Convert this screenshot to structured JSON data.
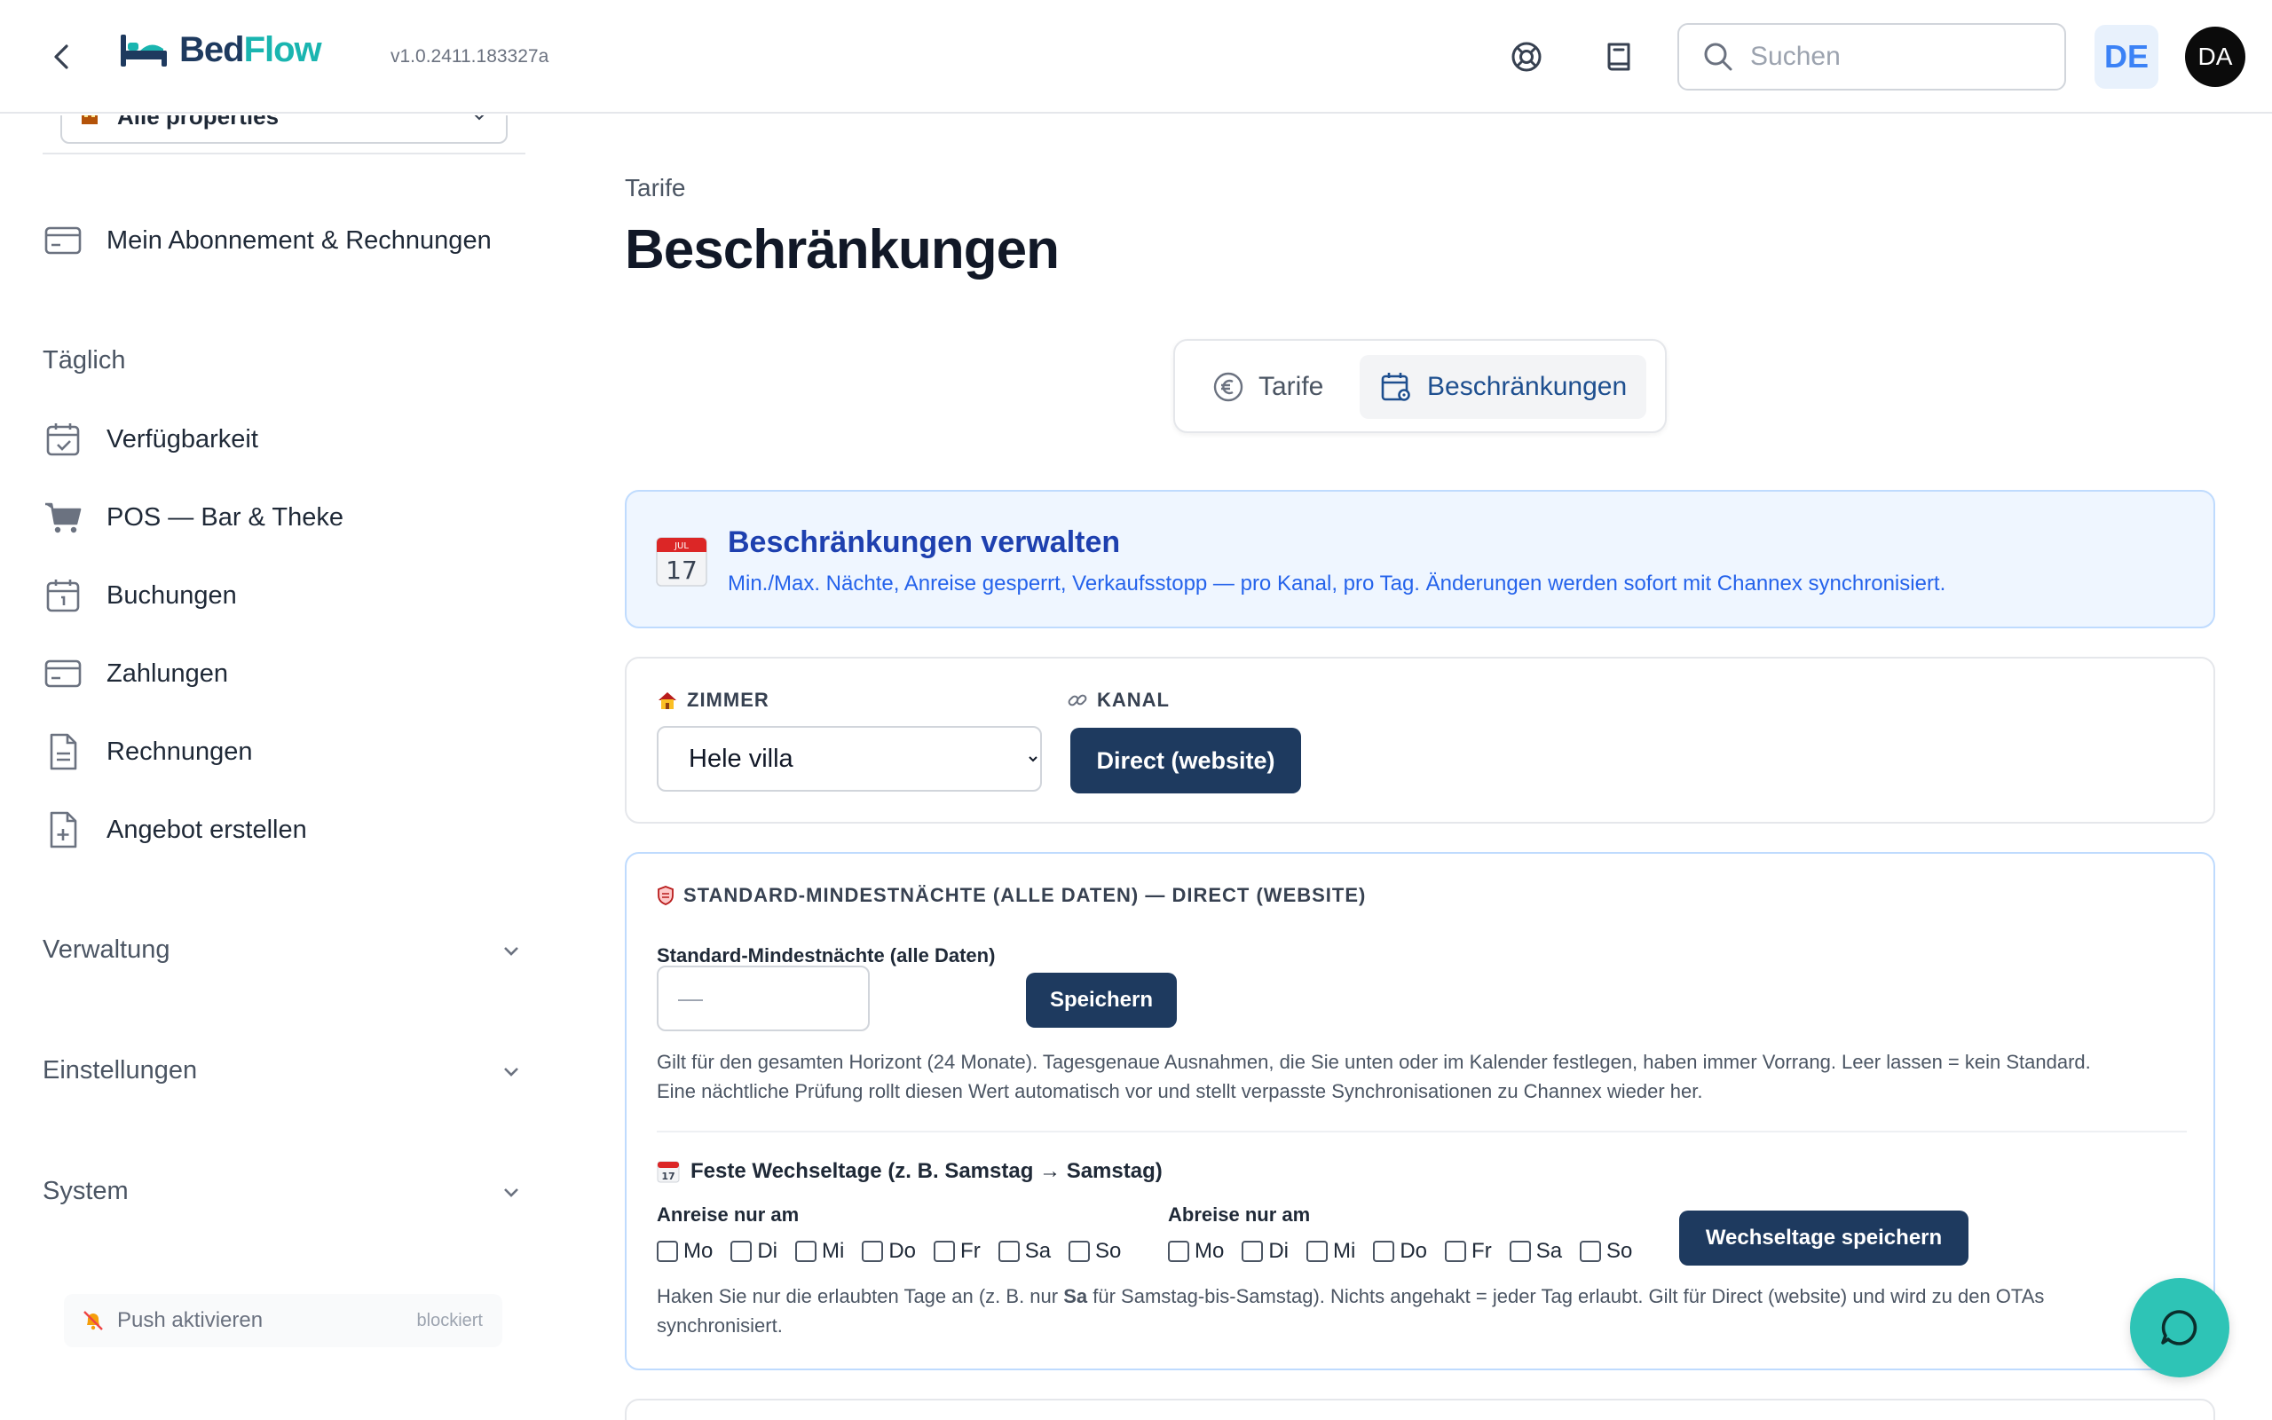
{
  "app": {
    "name_a": "Bed",
    "name_b": "Flow",
    "version": "v1.0.2411.183327a"
  },
  "header": {
    "search_placeholder": "Suchen",
    "language": "DE",
    "avatar_initials": "DA"
  },
  "sidebar": {
    "property_select": "Alle properties",
    "subscription": "Mein Abonnement & Rechnungen",
    "section_daily": "Täglich",
    "items": [
      {
        "label": "Verfügbarkeit",
        "icon": "calendar-check-icon"
      },
      {
        "label": "POS — Bar & Theke",
        "icon": "cart-icon"
      },
      {
        "label": "Buchungen",
        "icon": "calendar-icon"
      },
      {
        "label": "Zahlungen",
        "icon": "credit-card-icon"
      },
      {
        "label": "Rechnungen",
        "icon": "document-icon"
      },
      {
        "label": "Angebot erstellen",
        "icon": "document-plus-icon"
      }
    ],
    "sections": [
      {
        "label": "Verwaltung"
      },
      {
        "label": "Einstellungen"
      },
      {
        "label": "System"
      }
    ],
    "push": {
      "label": "Push aktivieren",
      "status": "blockiert"
    }
  },
  "main": {
    "breadcrumb": "Tarife",
    "title": "Beschränkungen",
    "tabs": [
      {
        "label": "Tarife",
        "active": false
      },
      {
        "label": "Beschränkungen",
        "active": true
      }
    ],
    "info": {
      "title": "Beschränkungen verwalten",
      "text": "Min./Max. Nächte, Anreise gesperrt, Verkaufsstopp — pro Kanal, pro Tag. Änderungen werden sofort mit Channex synchronisiert."
    },
    "filters": {
      "room_label": "ZIMMER",
      "room_value": "Hele villa",
      "channel_label": "KANAL",
      "channel_value": "Direct (website)"
    },
    "min_nights": {
      "header": "STANDARD-MINDESTNÄCHTE (ALLE DATEN) — DIRECT (WEBSITE)",
      "field_label": "Standard-Mindestnächte (alle Daten)",
      "placeholder": "—",
      "save": "Speichern",
      "help_1": "Gilt für den gesamten Horizont (24 Monate). Tagesgenaue Ausnahmen, die Sie unten oder im Kalender festlegen, haben immer Vorrang. Leer lassen = kein Standard.",
      "help_2": "Eine nächtliche Prüfung rollt diesen Wert automatisch vor und stellt verpasste Synchronisationen zu Channex wieder her."
    },
    "changeover": {
      "title": "Feste Wechseltage (z. B. Samstag → Samstag)",
      "arrival_label": "Anreise nur am",
      "departure_label": "Abreise nur am",
      "days": [
        "Mo",
        "Di",
        "Mi",
        "Do",
        "Fr",
        "Sa",
        "So"
      ],
      "save": "Wechseltage speichern",
      "help_pre": "Haken Sie nur die erlaubten Tage an (z. B. nur ",
      "help_bold": "Sa",
      "help_post": " für Samstag-bis-Samstag). Nichts angehakt = jeder Tag erlaubt. Gilt für Direct (website) und wird zu den OTAs",
      "help_line2": "synchronisiert."
    }
  }
}
